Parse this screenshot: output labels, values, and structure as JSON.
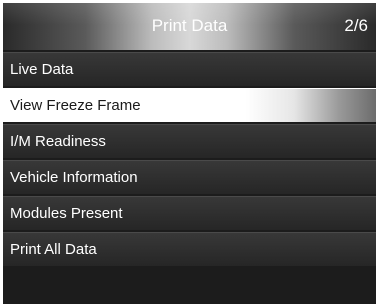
{
  "header": {
    "title": "Print Data",
    "page_indicator": "2/6"
  },
  "menu": {
    "items": [
      {
        "label": "Live Data"
      },
      {
        "label": "View Freeze Frame"
      },
      {
        "label": "I/M Readiness"
      },
      {
        "label": "Vehicle Information"
      },
      {
        "label": "Modules Present"
      },
      {
        "label": "Print All Data"
      }
    ],
    "selected_item": "View Freeze Frame"
  },
  "colors": {
    "background": "#1c1c1c",
    "menu_item": "#2e2e2e",
    "highlight": "#ffffff",
    "text": "#ffffff",
    "highlight_text": "#1a1a1a"
  }
}
